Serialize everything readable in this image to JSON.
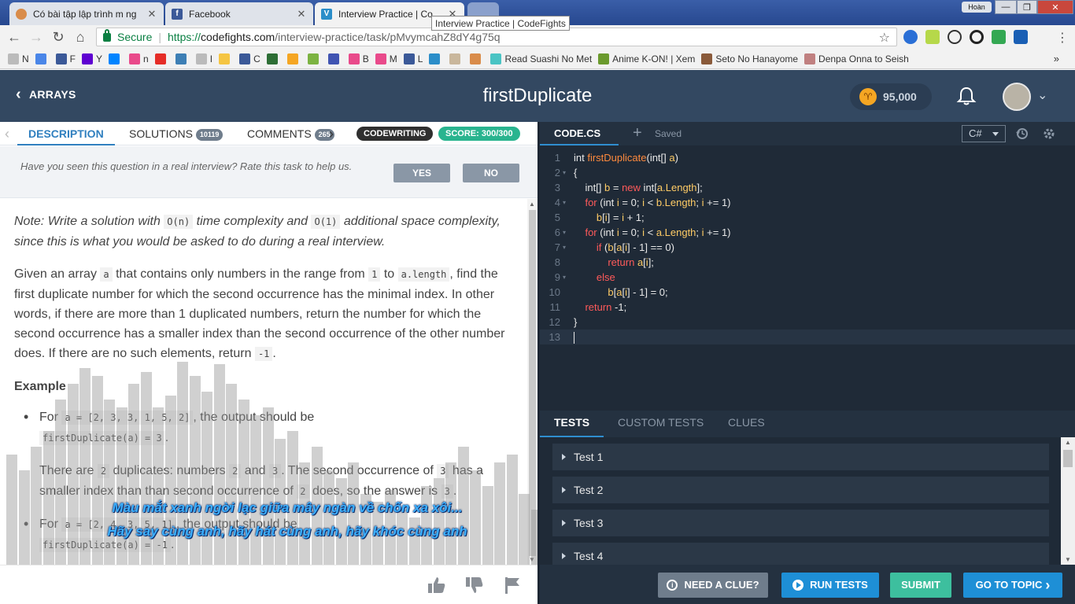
{
  "browser": {
    "tabs": [
      {
        "title": "Có bài tập lập trình m ng",
        "color": "#d98c4a"
      },
      {
        "title": "Facebook",
        "color": "#3b5998",
        "glyph": "f"
      },
      {
        "title": "Interview Practice | Co",
        "color": "#2b8ec9",
        "glyph": "V"
      }
    ],
    "tooltip": "Interview Practice | CodeFights",
    "profile": "Hoàn",
    "secure_label": "Secure",
    "url_scheme": "https://",
    "url_host": "codefights.com",
    "url_path": "/interview-practice/task/pMvymcahZ8dY4g75q",
    "bookmarks": [
      {
        "label": "N",
        "color": "#bbb"
      },
      {
        "label": "",
        "color": "#4a86e8"
      },
      {
        "label": "F",
        "color": "#3b5998"
      },
      {
        "label": "Y",
        "color": "#5f01d1"
      },
      {
        "label": "",
        "color": "#0084ff"
      },
      {
        "label": "n",
        "color": "#e94a8b"
      },
      {
        "label": "",
        "color": "#e52d27"
      },
      {
        "label": "",
        "color": "#3d7fb5"
      },
      {
        "label": "I",
        "color": "#bbb"
      },
      {
        "label": "",
        "color": "#f5c542"
      },
      {
        "label": "C",
        "color": "#3b5998"
      },
      {
        "label": "",
        "color": "#2d6e35"
      },
      {
        "label": "",
        "color": "#f5a623"
      },
      {
        "label": "",
        "color": "#7cb342"
      },
      {
        "label": "",
        "color": "#4054b2"
      },
      {
        "label": "B",
        "color": "#e94a8b"
      },
      {
        "label": "M",
        "color": "#e94a8b"
      },
      {
        "label": "L",
        "color": "#3b5998"
      },
      {
        "label": "",
        "color": "#2b8ec9"
      },
      {
        "label": "",
        "color": "#c9b79c"
      },
      {
        "label": "",
        "color": "#d98c4a"
      },
      {
        "label": "Read Suashi No Met",
        "color": "#4ac4c4"
      },
      {
        "label": "Anime K-ON! | Xem",
        "color": "#6b9a2d"
      },
      {
        "label": "Seto No Hanayome",
        "color": "#8a5a3a"
      },
      {
        "label": "Denpa Onna to Seish",
        "color": "#c08080"
      }
    ],
    "bookmarks_more": "»"
  },
  "header": {
    "back_label": "ARRAYS",
    "title": "firstDuplicate",
    "coins": "95,000"
  },
  "left_tabs": {
    "description": "DESCRIPTION",
    "solutions": "SOLUTIONS",
    "solutions_count": "10119",
    "comments": "COMMENTS",
    "comments_count": "265",
    "mode": "CODEWRITING",
    "score": "SCORE: 300/300"
  },
  "rate": {
    "question": "Have you seen this question in a real interview? Rate this task to help us.",
    "yes": "YES",
    "no": "NO"
  },
  "description": {
    "note_a": "Note: Write a solution with ",
    "note_code1": "O(n)",
    "note_b": " time complexity and ",
    "note_code2": "O(1)",
    "note_c": " additional space complexity, since this is what you would be asked to do during a real interview.",
    "p_a": "Given an array ",
    "p_code1": "a",
    "p_b": " that contains only numbers in the range from ",
    "p_code2": "1",
    "p_c": " to ",
    "p_code3": "a.length",
    "p_d": ", find the first duplicate number for which the second occurrence has the minimal index. In other words, if there are more than 1 duplicated numbers, return the number for which the second occurrence has a smaller index than the second occurrence of the other number does. If there are no such elements, return ",
    "p_code4": "-1",
    "p_e": ".",
    "example_title": "Example",
    "ex1_a": "For ",
    "ex1_code1": "a = [2, 3, 3, 1, 5, 2]",
    "ex1_b": ", the output should be",
    "ex1_code2": "firstDuplicate(a) = 3",
    "ex1_c": ".",
    "ex1_sub_a": "There are ",
    "ex1_sub_code1": "2",
    "ex1_sub_b": " duplicates: numbers ",
    "ex1_sub_code2": "2",
    "ex1_sub_c": " and ",
    "ex1_sub_code3": "3",
    "ex1_sub_d": ". The second occurrence of ",
    "ex1_sub_code4": "3",
    "ex1_sub_e": " has a smaller index than than second occurrence of ",
    "ex1_sub_code5": "2",
    "ex1_sub_f": " does, so the answer is ",
    "ex1_sub_code6": "3",
    "ex1_sub_g": ".",
    "ex2_a": "For ",
    "ex2_code1": "a = [2, 4, 3, 5, 1]",
    "ex2_b": ", the output should be",
    "ex2_code2": "firstDuplicate(a) = -1",
    "ex2_c": "."
  },
  "subtitles": {
    "line1": "Màu mắt xanh ngời lạc giữa mây ngàn về chốn xa xôi...",
    "line2": "Hãy say cùng anh, hãy hát cùng anh, hãy khóc cùng anh"
  },
  "editor": {
    "file_tab": "CODE.CS",
    "saved": "Saved",
    "language": "C#"
  },
  "code_lines": [
    {
      "n": "1",
      "fold": "",
      "html": "int <span class=\"fn\">firstDuplicate</span>(int[] <span class=\"prop\">a</span>)"
    },
    {
      "n": "2",
      "fold": "▾",
      "html": "{"
    },
    {
      "n": "3",
      "fold": "",
      "html": "    int[] <span class=\"prop\">b</span> = <span class=\"kw\">new</span> int[<span class=\"prop\">a.Length</span>];"
    },
    {
      "n": "4",
      "fold": "▾",
      "html": "    <span class=\"kw\">for</span> (int <span class=\"prop\">i</span> = 0; <span class=\"prop\">i</span> &lt; <span class=\"prop\">b.Length</span>; <span class=\"prop\">i</span> += 1)"
    },
    {
      "n": "5",
      "fold": "",
      "html": "        <span class=\"prop\">b</span>[<span class=\"prop\">i</span>] = <span class=\"prop\">i</span> + 1;"
    },
    {
      "n": "6",
      "fold": "▾",
      "html": "    <span class=\"kw\">for</span> (int <span class=\"prop\">i</span> = 0; <span class=\"prop\">i</span> &lt; <span class=\"prop\">a.Length</span>; <span class=\"prop\">i</span> += 1)"
    },
    {
      "n": "7",
      "fold": "▾",
      "html": "        <span class=\"kw\">if</span> (<span class=\"prop\">b</span>[<span class=\"prop\">a</span>[<span class=\"prop\">i</span>] - 1] == 0)"
    },
    {
      "n": "8",
      "fold": "",
      "html": "            <span class=\"kw\">return</span> <span class=\"prop\">a</span>[<span class=\"prop\">i</span>];"
    },
    {
      "n": "9",
      "fold": "▾",
      "html": "        <span class=\"kw\">else</span>"
    },
    {
      "n": "10",
      "fold": "",
      "html": "            <span class=\"prop\">b</span>[<span class=\"prop\">a</span>[<span class=\"prop\">i</span>] - 1] = 0;"
    },
    {
      "n": "11",
      "fold": "",
      "html": "    <span class=\"kw\">return</span> -1;"
    },
    {
      "n": "12",
      "fold": "",
      "html": "}"
    },
    {
      "n": "13",
      "fold": "",
      "html": "<span class=\"cursor\"></span>"
    }
  ],
  "tests": {
    "tab_tests": "TESTS",
    "tab_custom": "CUSTOM TESTS",
    "tab_clues": "CLUES",
    "items": [
      "Test 1",
      "Test 2",
      "Test 3",
      "Test 4"
    ]
  },
  "actions": {
    "clue": "NEED A CLUE?",
    "run": "RUN TESTS",
    "submit": "SUBMIT",
    "topic": "GO TO TOPIC"
  },
  "colors": {
    "header_bg": "#334861",
    "accent_blue": "#2f7fbf",
    "score_green": "#29b48f",
    "run_blue": "#1e8fd6",
    "submit_teal": "#3dbf9e",
    "clue_grey": "#6f7d8c"
  }
}
